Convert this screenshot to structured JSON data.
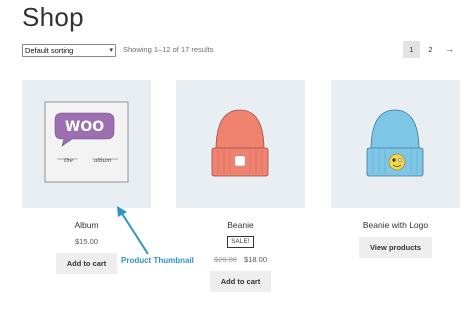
{
  "page": {
    "title": "Shop"
  },
  "toolbar": {
    "sorting": {
      "selected": "Default sorting"
    },
    "result_count": "Showing 1–12 of 17 results"
  },
  "pagination": {
    "pages": [
      "1",
      "2"
    ],
    "current": "1",
    "next_symbol": "→"
  },
  "products": [
    {
      "title": "Album",
      "price": "$15.00",
      "button": "Add to cart",
      "image": "album-woo-cover"
    },
    {
      "title": "Beanie",
      "sale_badge": "SALE!",
      "old_price": "$20.00",
      "price": "$18.00",
      "button": "Add to cart",
      "image": "orange-beanie"
    },
    {
      "title": "Beanie with Logo",
      "button": "View products",
      "image": "blue-beanie-with-logo"
    }
  ],
  "annotation": {
    "label": "Product Thumbnail",
    "color": "#2e94c6"
  },
  "colors": {
    "thumbnail_bg": "#e9eef2",
    "button_bg": "#eeeeee",
    "woo_purple": "#9b6fb0",
    "beanie_orange": "#f0836f",
    "beanie_blue": "#7ec6e6"
  }
}
